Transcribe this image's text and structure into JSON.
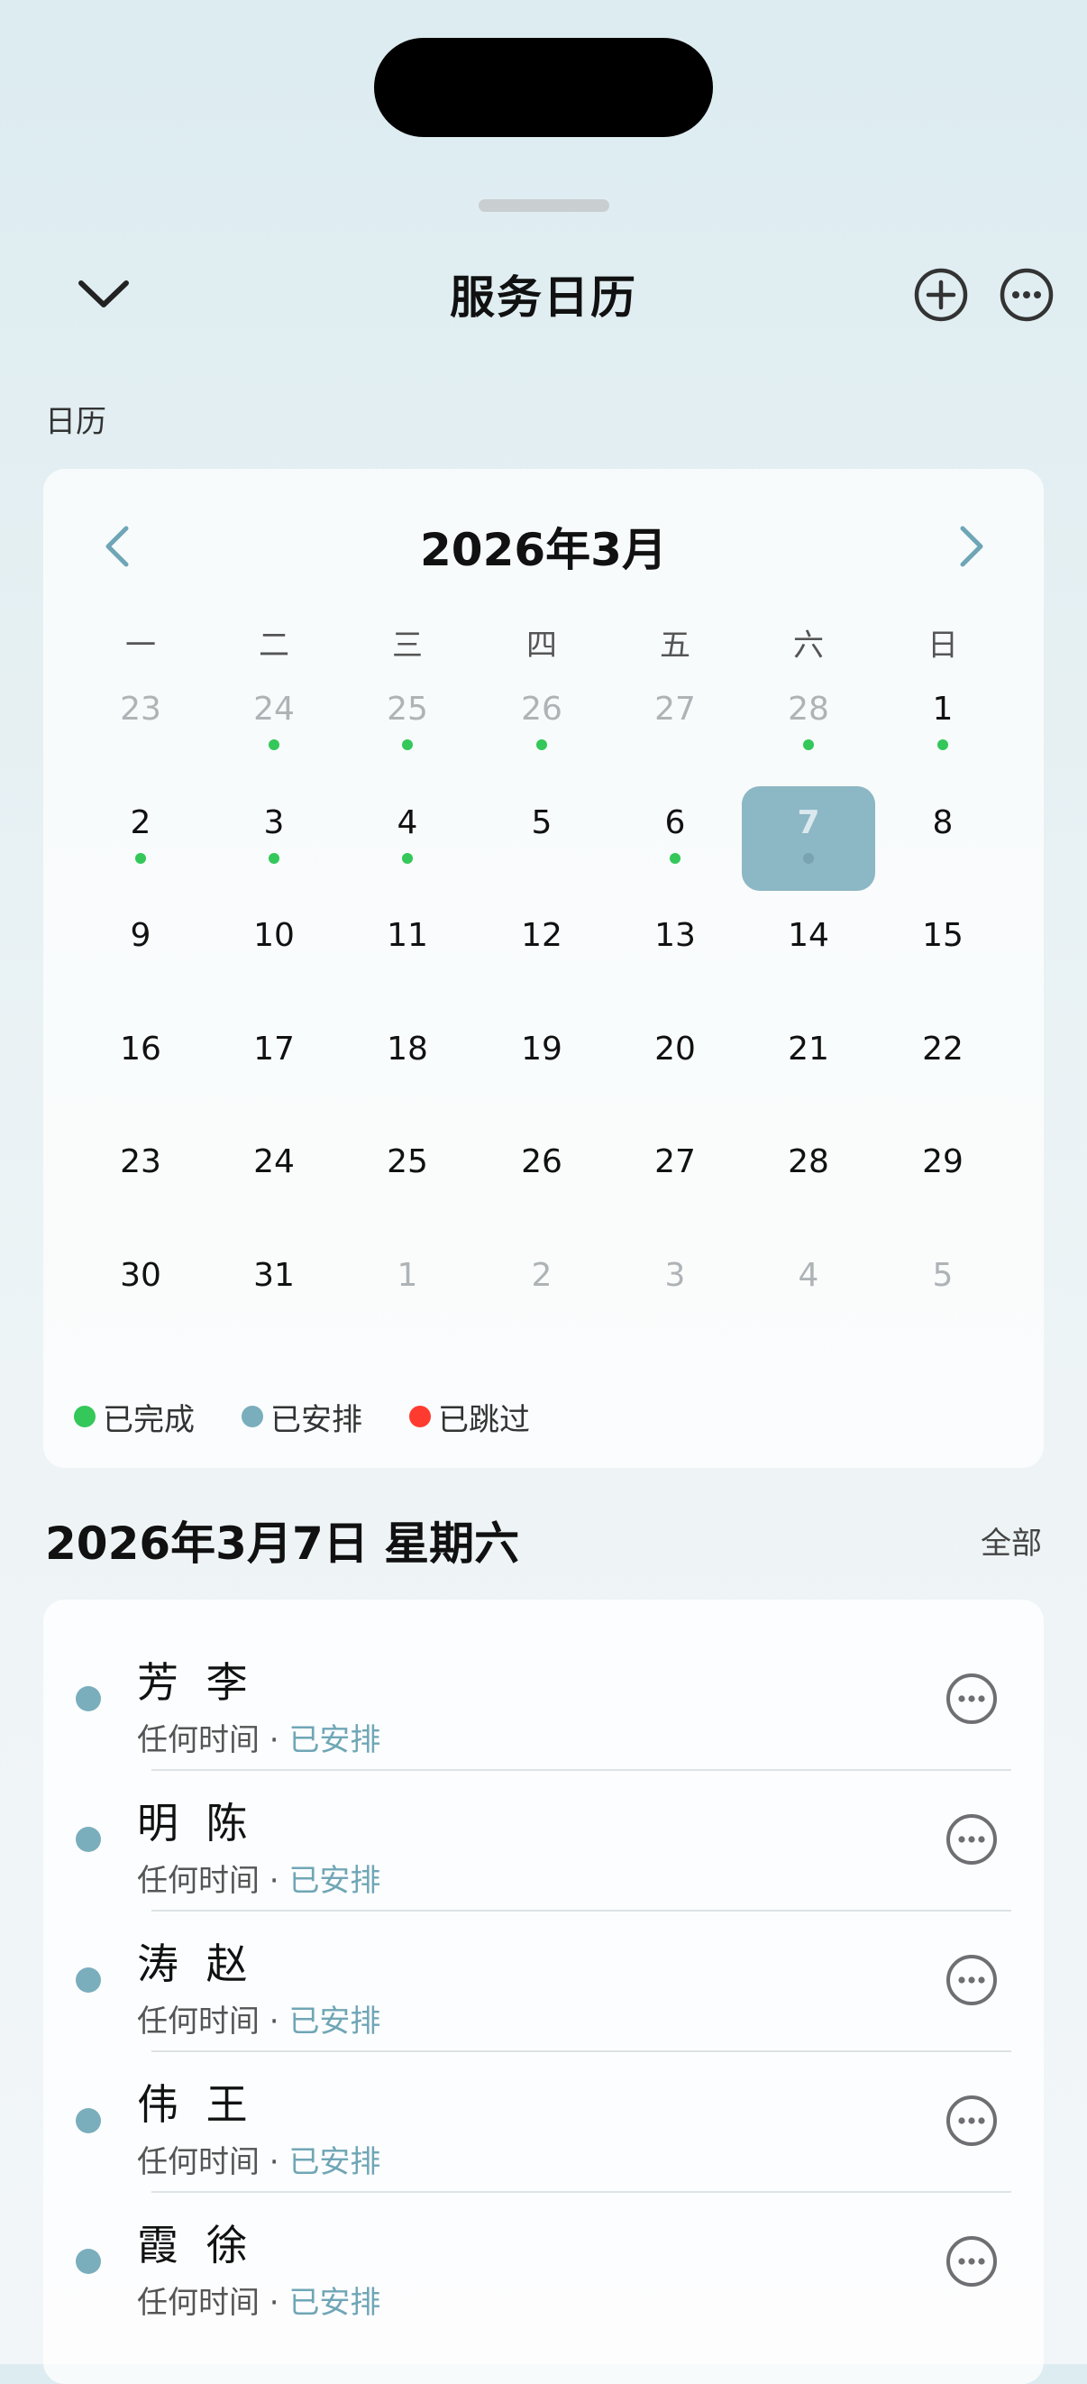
{
  "header": {
    "title": "服务日历"
  },
  "section_label": "日历",
  "calendar": {
    "month_title": "2026年3月",
    "weekdays": [
      "一",
      "二",
      "三",
      "四",
      "五",
      "六",
      "日"
    ],
    "days": [
      {
        "label": "23",
        "muted": true,
        "dot": "none"
      },
      {
        "label": "24",
        "muted": true,
        "dot": "green"
      },
      {
        "label": "25",
        "muted": true,
        "dot": "green"
      },
      {
        "label": "26",
        "muted": true,
        "dot": "green"
      },
      {
        "label": "27",
        "muted": true,
        "dot": "none"
      },
      {
        "label": "28",
        "muted": true,
        "dot": "green"
      },
      {
        "label": "1",
        "muted": false,
        "dot": "green"
      },
      {
        "label": "2",
        "muted": false,
        "dot": "green"
      },
      {
        "label": "3",
        "muted": false,
        "dot": "green"
      },
      {
        "label": "4",
        "muted": false,
        "dot": "green"
      },
      {
        "label": "5",
        "muted": false,
        "dot": "none"
      },
      {
        "label": "6",
        "muted": false,
        "dot": "green"
      },
      {
        "label": "7",
        "muted": false,
        "dot": "blue",
        "selected": true
      },
      {
        "label": "8",
        "muted": false,
        "dot": "none"
      },
      {
        "label": "9",
        "muted": false,
        "dot": "none"
      },
      {
        "label": "10",
        "muted": false,
        "dot": "none"
      },
      {
        "label": "11",
        "muted": false,
        "dot": "none"
      },
      {
        "label": "12",
        "muted": false,
        "dot": "none"
      },
      {
        "label": "13",
        "muted": false,
        "dot": "none"
      },
      {
        "label": "14",
        "muted": false,
        "dot": "none"
      },
      {
        "label": "15",
        "muted": false,
        "dot": "none"
      },
      {
        "label": "16",
        "muted": false,
        "dot": "none"
      },
      {
        "label": "17",
        "muted": false,
        "dot": "none"
      },
      {
        "label": "18",
        "muted": false,
        "dot": "none"
      },
      {
        "label": "19",
        "muted": false,
        "dot": "none"
      },
      {
        "label": "20",
        "muted": false,
        "dot": "none"
      },
      {
        "label": "21",
        "muted": false,
        "dot": "none"
      },
      {
        "label": "22",
        "muted": false,
        "dot": "none"
      },
      {
        "label": "23",
        "muted": false,
        "dot": "none"
      },
      {
        "label": "24",
        "muted": false,
        "dot": "none"
      },
      {
        "label": "25",
        "muted": false,
        "dot": "none"
      },
      {
        "label": "26",
        "muted": false,
        "dot": "none"
      },
      {
        "label": "27",
        "muted": false,
        "dot": "none"
      },
      {
        "label": "28",
        "muted": false,
        "dot": "none"
      },
      {
        "label": "29",
        "muted": false,
        "dot": "none"
      },
      {
        "label": "30",
        "muted": false,
        "dot": "none"
      },
      {
        "label": "31",
        "muted": false,
        "dot": "none"
      },
      {
        "label": "1",
        "muted": true,
        "dot": "none"
      },
      {
        "label": "2",
        "muted": true,
        "dot": "none"
      },
      {
        "label": "3",
        "muted": true,
        "dot": "none"
      },
      {
        "label": "4",
        "muted": true,
        "dot": "none"
      },
      {
        "label": "5",
        "muted": true,
        "dot": "none"
      }
    ],
    "legend": [
      {
        "label": "已完成",
        "color": "#34c759"
      },
      {
        "label": "已安排",
        "color": "#7aaebc"
      },
      {
        "label": "已跳过",
        "color": "#ff3b30"
      }
    ]
  },
  "colors": {
    "dot_green": "#34c759",
    "dot_blue": "#7aaebc",
    "dot_selected": "#9dbfcb",
    "status_text": "#6fa6b6"
  },
  "agenda": {
    "date_title": "2026年3月7日 星期六",
    "all_label": "全部",
    "items": [
      {
        "name": "芳 李",
        "time": "任何时间",
        "separator": " · ",
        "status": "已安排"
      },
      {
        "name": "明 陈",
        "time": "任何时间",
        "separator": " · ",
        "status": "已安排"
      },
      {
        "name": "涛 赵",
        "time": "任何时间",
        "separator": " · ",
        "status": "已安排"
      },
      {
        "name": "伟 王",
        "time": "任何时间",
        "separator": " · ",
        "status": "已安排"
      },
      {
        "name": "霞 徐",
        "time": "任何时间",
        "separator": " · ",
        "status": "已安排"
      }
    ]
  }
}
